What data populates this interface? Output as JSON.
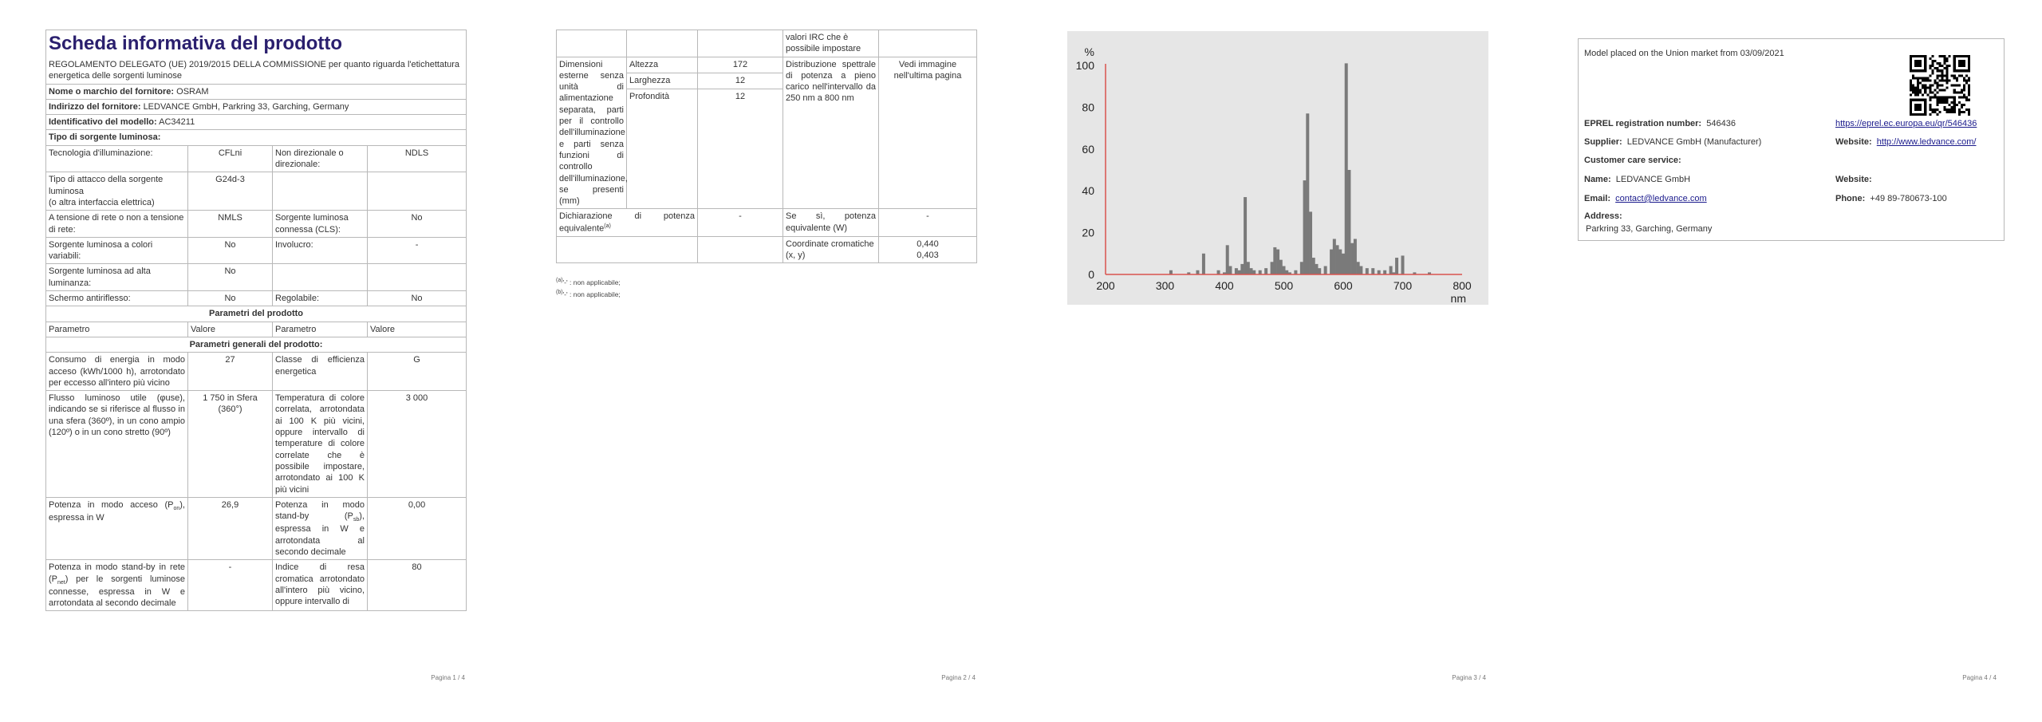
{
  "page1": {
    "title": "Scheda informativa del prodotto",
    "regulation": "REGOLAMENTO DELEGATO (UE) 2019/2015 DELLA COMMISSIONE per quanto riguarda l'etichettatura energetica delle sorgenti luminose",
    "supplier_name_label": "Nome o marchio del fornitore:",
    "supplier_name": "OSRAM",
    "supplier_address_label": "Indirizzo del fornitore:",
    "supplier_address": "LEDVANCE GmbH, Parkring 33, Garching, Germany",
    "model_id_label": "Identificativo del modello:",
    "model_id": "AC34211",
    "source_type_label": "Tipo di sorgente luminosa:",
    "rows": {
      "tech_label": "Tecnologia d'illuminazione:",
      "tech_value": "CFLni",
      "nondir_label": "Non direzionale o direzionale:",
      "nondir_value": "NDLS",
      "cap_label": "Tipo di attacco della sorgente luminosa",
      "cap_sub": "(o altra interfaccia elettrica)",
      "cap_value": "G24d-3",
      "mains_label": "A tensione di rete o non a tensione di rete:",
      "mains_value": "NMLS",
      "cls_label": "Sorgente luminosa connessa (CLS):",
      "cls_value": "No",
      "colour_label": "Sorgente luminosa a colori variabili:",
      "colour_value": "No",
      "envelope_label": "Involucro:",
      "envelope_value": "-",
      "hl_label": "Sorgente luminosa ad alta luminanza:",
      "hl_value": "No",
      "glare_label": "Schermo antiriflesso:",
      "glare_value": "No",
      "dim_label": "Regolabile:",
      "dim_value": "No"
    },
    "params_header": "Parametri del prodotto",
    "col_param": "Parametro",
    "col_value": "Valore",
    "general_header": "Parametri generali del prodotto:",
    "energy_label": "Consumo di energia in modo acceso (kWh/1000 h), arrotondato per eccesso all'intero più vicino",
    "energy_value": "27",
    "class_label": "Classe di efficienza energetica",
    "class_value": "G",
    "flux_label": "Flusso luminoso utile (φuse), indicando se si riferisce al flusso in una sfera (360º), in un cono ampio (120º) o in un cono stretto (90º)",
    "flux_value": "1 750 in Sfera (360°)",
    "cct_label": "Temperatura di colore correlata, arrotondata ai 100 K più vicini, oppure intervallo di temperature di colore correlate che è possibile impostare, arrotondato ai 100 K più vicini",
    "cct_value": "3 000",
    "pon_label_a": "Potenza in modo acceso (P",
    "pon_sub": "on",
    "pon_label_b": "), espressa in W",
    "pon_value": "26,9",
    "psb_label_a": "Potenza in modo stand-by (P",
    "psb_sub": "sb",
    "psb_label_b": "), espressa in W e arrotondata al secondo decimale",
    "psb_value": "0,00",
    "pnet_label_a": "Potenza in modo stand-by in rete (P",
    "pnet_sub": "net",
    "pnet_label_b": ") per le sorgenti luminose connesse, espressa in W e arrotondata al secondo decimale",
    "pnet_value": "-",
    "cri_label": "Indice di resa cromatica arrotondato all'intero più vicino, oppure intervallo di",
    "cri_value": "80",
    "page_num": "Pagina 1 / 4"
  },
  "page2": {
    "cri_cont": "valori IRC che è possibile impostare",
    "dims_label": "Dimensioni esterne senza unità di alimentazione separata, parti per il controllo dell'illuminazione e parti senza funzioni di controllo dell'illuminazione, se presenti (mm)",
    "height_label": "Altezza",
    "height_value": "172",
    "width_label": "Larghezza",
    "width_value": "12",
    "depth_label": "Profondità",
    "depth_value": "12",
    "spd_label": "Distribuzione spettrale di potenza a pieno carico nell'intervallo da 250 nm a 800 nm",
    "spd_value": "Vedi immagine nell'ultima pagina",
    "equiv_label_a": "Dichiarazione di potenza equivalente",
    "equiv_sup": "(a)",
    "equiv_value": "-",
    "equiv_w_label": "Se sì, potenza equivalente (W)",
    "equiv_w_value": "-",
    "chroma_label": "Coordinate cromatiche (x, y)",
    "chroma_x": "0,440",
    "chroma_y": "0,403",
    "note_a": "(a)",
    "note_a_text": "'-' : non applicabile;",
    "note_b": "(b)",
    "note_b_text": "'-' : non applicabile;",
    "page_num": "Pagina 2 / 4"
  },
  "page3": {
    "page_num": "Pagina 3 / 4"
  },
  "page4": {
    "placed": "Model placed on the Union market from 03/09/2021",
    "eprel_label": "EPREL registration number:",
    "eprel_value": "546436",
    "eprel_url": "https://eprel.ec.europa.eu/qr/546436",
    "supplier_label": "Supplier:",
    "supplier_value": "LEDVANCE GmbH (Manufacturer)",
    "website_label": "Website:",
    "website_value": "http://www.ledvance.com/",
    "care_label": "Customer care service:",
    "name_label": "Name:",
    "name_value": "LEDVANCE GmbH",
    "website2_label": "Website:",
    "email_label": "Email:",
    "email_value": "contact@ledvance.com",
    "phone_label": "Phone:",
    "phone_value": "+49 89-780673-100",
    "address_label": "Address:",
    "address_value": "Parkring 33, Garching, Germany",
    "page_num": "Pagina 4 / 4"
  },
  "chart_data": {
    "type": "bar",
    "title": "",
    "xlabel": "nm",
    "ylabel": "%",
    "xlim": [
      200,
      800
    ],
    "ylim": [
      0,
      100
    ],
    "xticks": [
      200,
      300,
      400,
      500,
      600,
      700,
      800
    ],
    "yticks": [
      0,
      20,
      40,
      60,
      80,
      100
    ],
    "grid": false,
    "axis_color": "#d9534f",
    "bar_color": "#7a7a7a",
    "x": [
      310,
      340,
      355,
      365,
      390,
      400,
      405,
      410,
      420,
      425,
      430,
      435,
      440,
      445,
      450,
      460,
      470,
      480,
      485,
      490,
      495,
      500,
      505,
      510,
      520,
      530,
      535,
      540,
      545,
      550,
      555,
      560,
      570,
      580,
      585,
      590,
      595,
      600,
      605,
      610,
      615,
      620,
      625,
      630,
      640,
      650,
      660,
      670,
      680,
      685,
      690,
      700,
      720,
      745
    ],
    "values": [
      2,
      1,
      2,
      10,
      2,
      1,
      14,
      4,
      3,
      2,
      5,
      37,
      6,
      3,
      2,
      2,
      3,
      6,
      13,
      12,
      7,
      4,
      2,
      1,
      2,
      6,
      45,
      77,
      30,
      8,
      5,
      3,
      4,
      12,
      17,
      14,
      12,
      10,
      101,
      50,
      15,
      17,
      6,
      4,
      3,
      3,
      2,
      2,
      4,
      1,
      8,
      9,
      1,
      1
    ]
  }
}
